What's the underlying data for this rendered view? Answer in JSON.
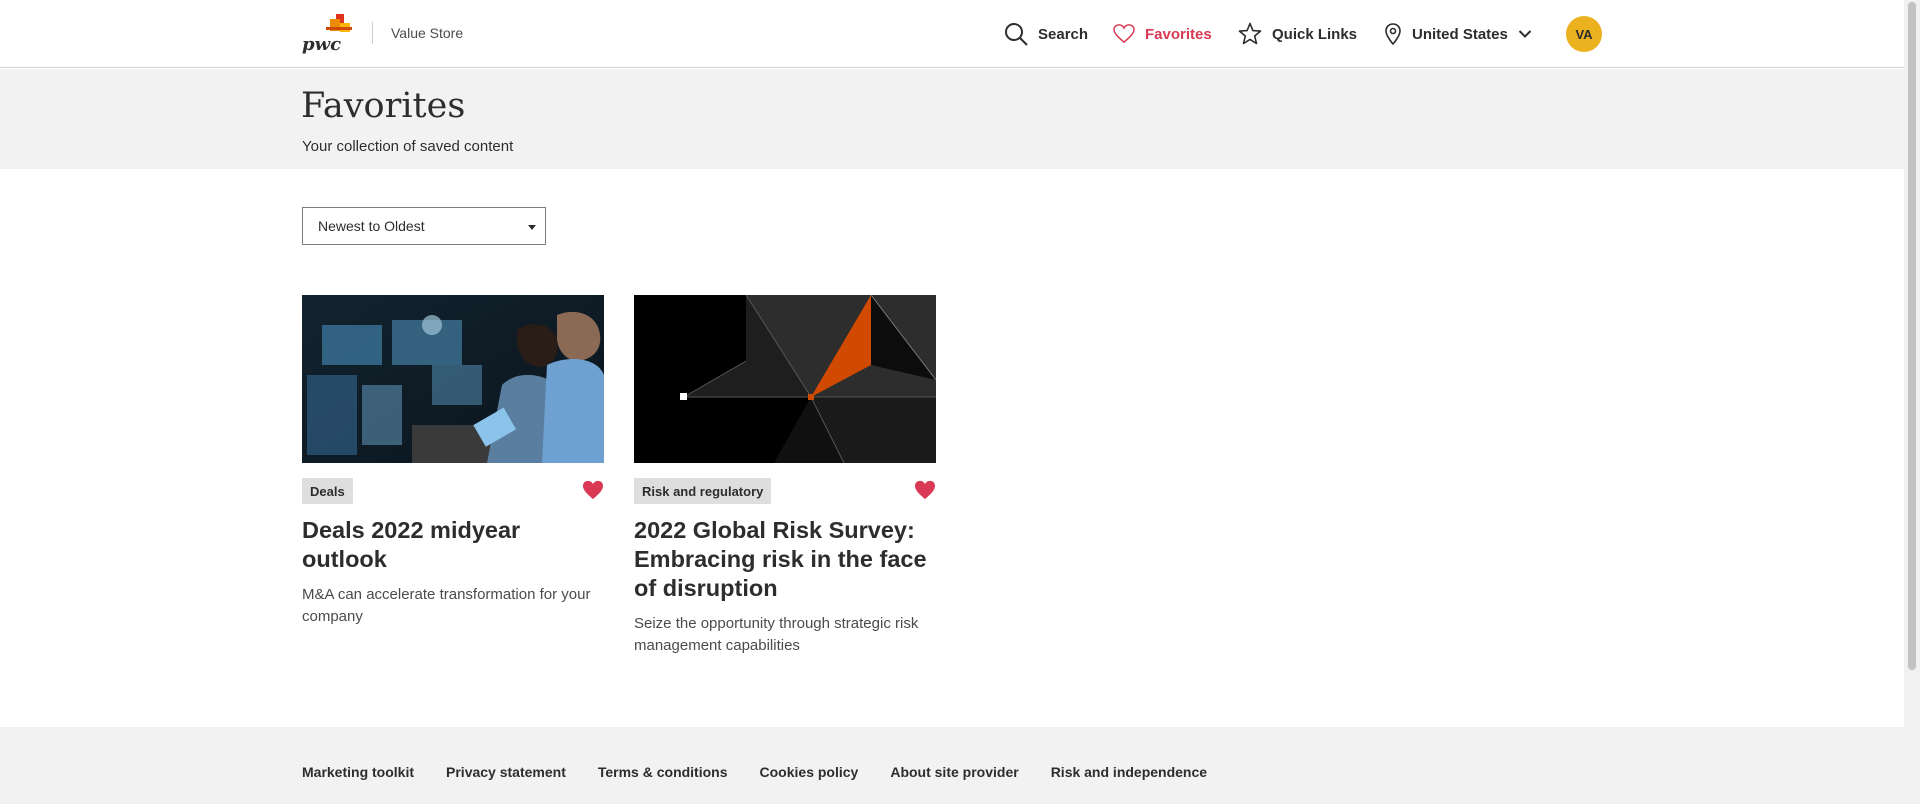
{
  "header": {
    "site_title": "Value Store",
    "nav": {
      "search_label": "Search",
      "favorites_label": "Favorites",
      "quick_links_label": "Quick Links",
      "country_label": "United States"
    },
    "avatar_initials": "VA"
  },
  "hero": {
    "title": "Favorites",
    "subtitle": "Your collection of saved content"
  },
  "sort": {
    "selected": "Newest to Oldest"
  },
  "cards": [
    {
      "tag": "Deals",
      "title": "Deals 2022 midyear outlook",
      "description": "M&A can accelerate transformation for your company",
      "favorited": true
    },
    {
      "tag": "Risk and regulatory",
      "title": "2022 Global Risk Survey: Embracing risk in the face of disruption",
      "description": "Seize the opportunity through strategic risk management capabilities",
      "favorited": true
    }
  ],
  "footer": {
    "links": [
      "Marketing toolkit",
      "Privacy statement",
      "Terms & conditions",
      "Cookies policy",
      "About site provider",
      "Risk and independence"
    ]
  },
  "colors": {
    "accent_red": "#d93954",
    "avatar_yellow": "#ebb11f",
    "brand_orange": "#d04a02"
  }
}
